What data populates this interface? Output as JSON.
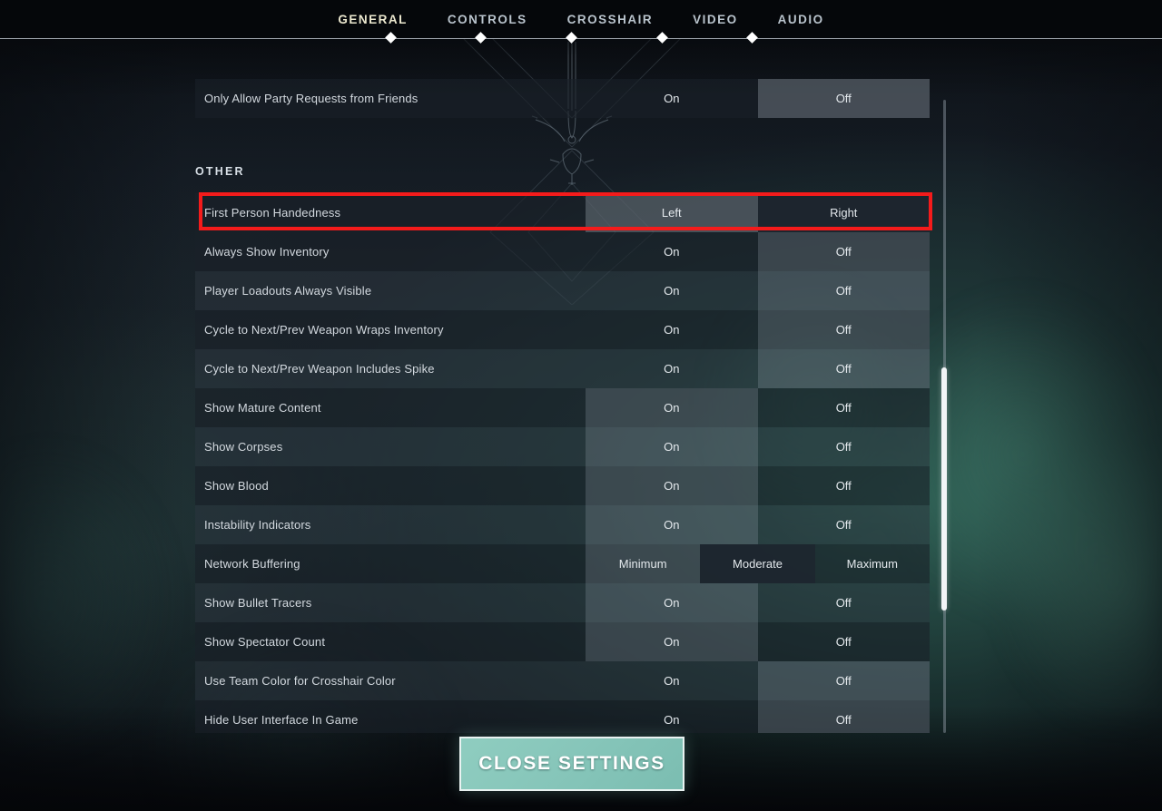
{
  "nav": {
    "tabs": [
      {
        "label": "GENERAL",
        "active": true
      },
      {
        "label": "CONTROLS",
        "active": false
      },
      {
        "label": "CROSSHAIR",
        "active": false
      },
      {
        "label": "VIDEO",
        "active": false
      },
      {
        "label": "AUDIO",
        "active": false
      }
    ]
  },
  "partial_row": {
    "label": "Only Allow Party Requests from Friends",
    "options": [
      "On",
      "Off"
    ],
    "selected": "Off"
  },
  "group": {
    "title": "OTHER"
  },
  "settings": [
    {
      "label": "First Person Handedness",
      "options": [
        "Left",
        "Right"
      ],
      "selected": "Left"
    },
    {
      "label": "Always Show Inventory",
      "options": [
        "On",
        "Off"
      ],
      "selected": "Off"
    },
    {
      "label": "Player Loadouts Always Visible",
      "options": [
        "On",
        "Off"
      ],
      "selected": "Off"
    },
    {
      "label": "Cycle to Next/Prev Weapon Wraps Inventory",
      "options": [
        "On",
        "Off"
      ],
      "selected": "Off"
    },
    {
      "label": "Cycle to Next/Prev Weapon Includes Spike",
      "options": [
        "On",
        "Off"
      ],
      "selected": "Off"
    },
    {
      "label": "Show Mature Content",
      "options": [
        "On",
        "Off"
      ],
      "selected": "On"
    },
    {
      "label": "Show Corpses",
      "options": [
        "On",
        "Off"
      ],
      "selected": "On"
    },
    {
      "label": "Show Blood",
      "options": [
        "On",
        "Off"
      ],
      "selected": "On"
    },
    {
      "label": "Instability Indicators",
      "options": [
        "On",
        "Off"
      ],
      "selected": "On"
    },
    {
      "label": "Network Buffering",
      "options": [
        "Minimum",
        "Moderate",
        "Maximum"
      ],
      "selected": "Moderate"
    },
    {
      "label": "Show Bullet Tracers",
      "options": [
        "On",
        "Off"
      ],
      "selected": "On"
    },
    {
      "label": "Show Spectator Count",
      "options": [
        "On",
        "Off"
      ],
      "selected": "On"
    },
    {
      "label": "Use Team Color for Crosshair Color",
      "options": [
        "On",
        "Off"
      ],
      "selected": "Off"
    },
    {
      "label": "Hide User Interface In Game",
      "options": [
        "On",
        "Off"
      ],
      "selected": "Off"
    }
  ],
  "footer": {
    "close_label": "CLOSE SETTINGS"
  },
  "annotation": {
    "highlight_row": "First Person Handedness",
    "highlight_color": "#f41b1b"
  },
  "colors": {
    "accent_button": "#87c6ba",
    "active_tab": "#ece8cf",
    "text_primary": "#d3d9df",
    "scrollbar_thumb": "#f2f5f7"
  }
}
